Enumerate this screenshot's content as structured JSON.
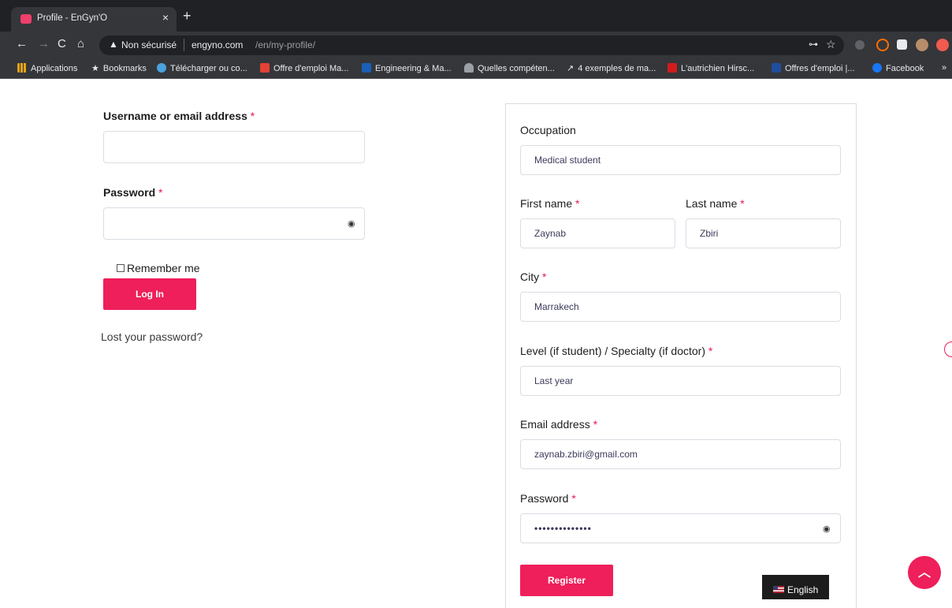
{
  "browser": {
    "tab_title": "Profile - EnGyn'O",
    "tab_close": "×",
    "new_tab": "+",
    "security_label": "Non sécurisé",
    "url_host": "engyno.com",
    "url_path": "/en/my-profile/",
    "bookmarks": [
      {
        "label": "Applications",
        "icon": "apps-grid-icon"
      },
      {
        "label": "Bookmarks",
        "icon": "star-icon"
      },
      {
        "label": "Télécharger ou co...",
        "icon": "download-site-icon"
      },
      {
        "label": "Offre d'emploi Ma...",
        "icon": "adobe-icon"
      },
      {
        "label": "Engineering & Ma...",
        "icon": "mp-icon"
      },
      {
        "label": "Quelles compéten...",
        "icon": "mountain-icon"
      },
      {
        "label": "4 exemples de ma...",
        "icon": "arrow-icon"
      },
      {
        "label": "L'autrichien Hirsc...",
        "icon": "un-icon"
      },
      {
        "label": "Offres d'emploi |...",
        "icon": "p-icon"
      },
      {
        "label": "Facebook",
        "icon": "facebook-icon"
      }
    ],
    "bookmarks_more": "»"
  },
  "login": {
    "username_label": "Username or email address",
    "password_label": "Password",
    "required_mark": "*",
    "remember_label": "Remember me",
    "login_button": "Log In",
    "lost_password": "Lost your password?"
  },
  "register": {
    "occupation_label": "Occupation",
    "occupation_value": "Medical student",
    "first_name_label": "First name",
    "first_name_value": "Zaynab",
    "last_name_label": "Last name",
    "last_name_value": "Zbiri",
    "city_label": "City",
    "city_value": "Marrakech",
    "level_label": "Level (if student) / Specialty (if doctor)",
    "level_value": "Last year",
    "email_label": "Email address",
    "email_value": "zaynab.zbiri@gmail.com",
    "password_label": "Password",
    "password_value": "••••••••••••••",
    "register_button": "Register"
  },
  "language_switcher": "English",
  "colors": {
    "accent": "#ee1f5a",
    "required": "#e8174b"
  }
}
